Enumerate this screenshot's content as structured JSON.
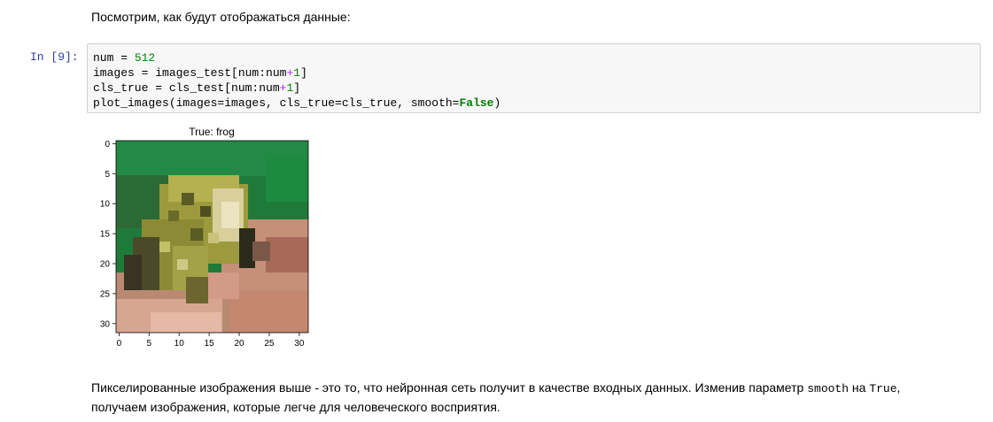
{
  "markdown": {
    "intro": "Посмотрим, как будут отображаться данные:",
    "outro_part1": "Пикселированные изображения выше - это то, что нейронная сеть получит в качестве входных данных. Изменив параметр ",
    "outro_code1": "smooth",
    "outro_part2": " на ",
    "outro_code2": "True",
    "outro_part3": ",",
    "outro_line2": "получаем изображения, которые легче для человеческого восприятия."
  },
  "cell": {
    "prompt": "In [9]:",
    "line1": {
      "a": "num = ",
      "b": "512"
    },
    "line2": {
      "a": "images = images_test[num:num",
      "op": "+",
      "n": "1",
      "end": "]"
    },
    "line3": {
      "a": "cls_true = cls_test[num:num",
      "op": "+",
      "n": "1",
      "end": "]"
    },
    "line4": {
      "a": "plot_images(images=images, cls_true=cls_true, smooth=",
      "kw": "False",
      "end": ")"
    }
  },
  "plot": {
    "title": "True: frog",
    "xticks": [
      "0",
      "5",
      "10",
      "15",
      "20",
      "25",
      "30"
    ],
    "yticks": [
      "0",
      "5",
      "10",
      "15",
      "20",
      "25",
      "30"
    ],
    "image_description_colors": [
      "#1f8a3f",
      "#2c6a2a",
      "#a5a23c",
      "#d9cfa0",
      "#c48a6e",
      "#e3b29c",
      "#3e3524"
    ]
  }
}
